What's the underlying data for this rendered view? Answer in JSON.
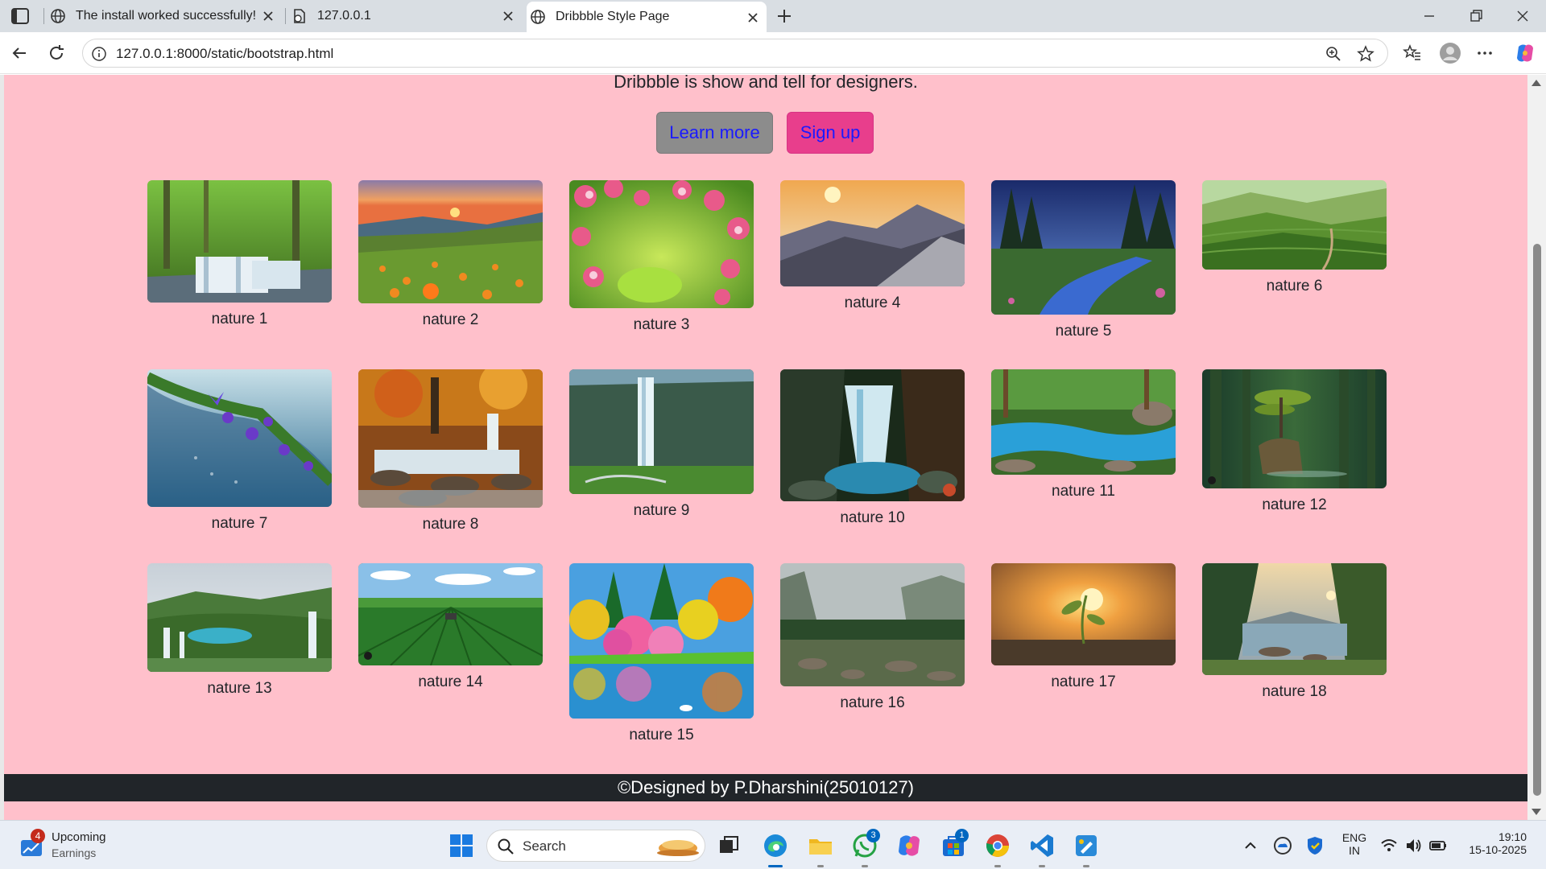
{
  "browser": {
    "tabs": [
      {
        "title": "The install worked successfully! Co",
        "icon": "globe-icon",
        "active": false
      },
      {
        "title": "127.0.0.1",
        "icon": "document-globe-icon",
        "active": false
      },
      {
        "title": "Dribbble Style Page",
        "icon": "globe-icon",
        "active": true
      }
    ],
    "url": "127.0.0.1:8000/static/bootstrap.html"
  },
  "page": {
    "tagline": "Dribbble is show and tell for designers.",
    "buttons": {
      "learn_more": "Learn more",
      "sign_up": "Sign up"
    },
    "gallery": [
      {
        "caption": "nature 1",
        "scene": "forest waterfall"
      },
      {
        "caption": "nature 2",
        "scene": "sunset flower meadow"
      },
      {
        "caption": "nature 3",
        "scene": "pink blossoms"
      },
      {
        "caption": "nature 4",
        "scene": "mountain sunrise"
      },
      {
        "caption": "nature 5",
        "scene": "night stream"
      },
      {
        "caption": "nature 6",
        "scene": "green tea hills"
      },
      {
        "caption": "nature 7",
        "scene": "purple flowers and butterfly"
      },
      {
        "caption": "nature 8",
        "scene": "autumn cascade"
      },
      {
        "caption": "nature 9",
        "scene": "waterfall cliff"
      },
      {
        "caption": "nature 10",
        "scene": "rocky waterfall"
      },
      {
        "caption": "nature 11",
        "scene": "turquoise river"
      },
      {
        "caption": "nature 12",
        "scene": "bonsai on rock"
      },
      {
        "caption": "nature 13",
        "scene": "lakes and falls"
      },
      {
        "caption": "nature 14",
        "scene": "crop field and tractor"
      },
      {
        "caption": "nature 15",
        "scene": "colorful trees reflection"
      },
      {
        "caption": "nature 16",
        "scene": "valley river"
      },
      {
        "caption": "nature 17",
        "scene": "sunset sprout"
      },
      {
        "caption": "nature 18",
        "scene": "lake with trees"
      }
    ],
    "footer": "©Designed by P.Dharshini(25010127)"
  },
  "taskbar": {
    "weather": {
      "badge": "4",
      "line1": "Upcoming",
      "line2": "Earnings"
    },
    "search_placeholder": "Search",
    "badges": {
      "whatsapp": "3",
      "store": "1"
    },
    "tray": {
      "lang1": "ENG",
      "lang2": "IN",
      "time": "19:10",
      "date": "15-10-2025"
    }
  },
  "colors": {
    "page_bg": "#ffc0cb",
    "learn_more_bg": "#8c8c8c",
    "sign_up_bg": "#e83e8c",
    "button_text": "#1a1aff",
    "footer_bg": "#212529"
  }
}
